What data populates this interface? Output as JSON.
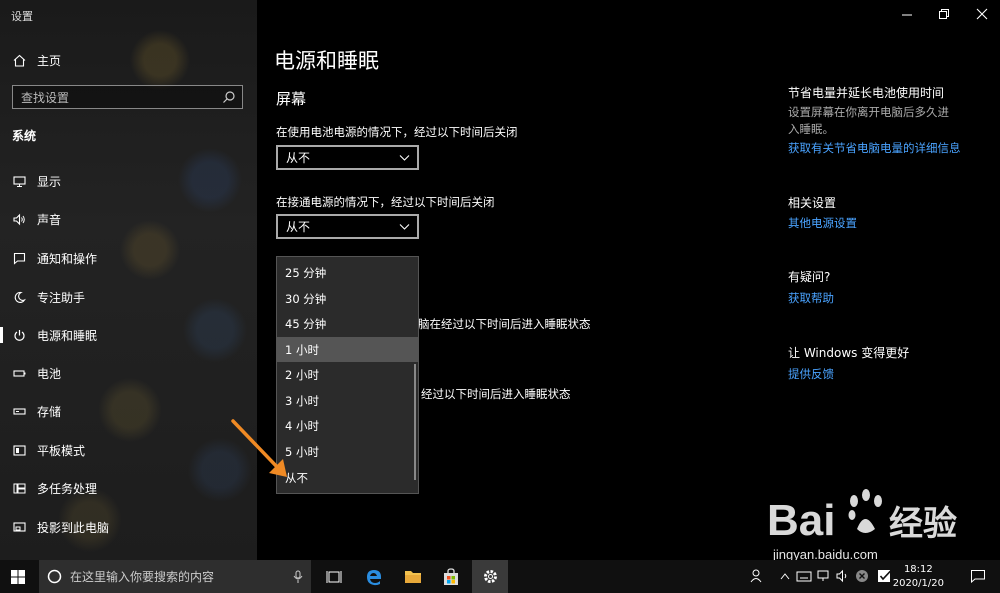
{
  "window": {
    "app_title": "设置"
  },
  "sidebar": {
    "home_label": "主页",
    "search_placeholder": "查找设置",
    "section_label": "系统",
    "items": [
      {
        "label": "显示",
        "icon": "monitor-icon"
      },
      {
        "label": "声音",
        "icon": "speaker-icon"
      },
      {
        "label": "通知和操作",
        "icon": "notification-icon"
      },
      {
        "label": "专注助手",
        "icon": "moon-icon"
      },
      {
        "label": "电源和睡眠",
        "icon": "power-icon",
        "active": true
      },
      {
        "label": "电池",
        "icon": "battery-icon"
      },
      {
        "label": "存储",
        "icon": "storage-icon"
      },
      {
        "label": "平板模式",
        "icon": "tablet-icon"
      },
      {
        "label": "多任务处理",
        "icon": "multitask-icon"
      },
      {
        "label": "投影到此电脑",
        "icon": "project-icon"
      }
    ]
  },
  "main": {
    "page_title": "电源和睡眠",
    "screen_heading": "屏幕",
    "battery_screen_label": "在使用电池电源的情况下，经过以下时间后关闭",
    "battery_screen_value": "从不",
    "plugged_screen_label": "在接通电源的情况下，经过以下时间后关闭",
    "plugged_screen_value": "从不",
    "sleep_battery_label_partial": "脑在经过以下时间后进入睡眠状态",
    "sleep_plugged_label_partial": "经过以下时间后进入睡眠状态",
    "dropdown": {
      "options": [
        "25 分钟",
        "30 分钟",
        "45 分钟",
        "1 小时",
        "2 小时",
        "3 小时",
        "4 小时",
        "5 小时",
        "从不"
      ],
      "selected_index": 3
    }
  },
  "right_panel": {
    "save_heading": "节省电量并延长电池使用时间",
    "save_text": "设置屏幕在你离开电脑后多久进入睡眠。",
    "save_link": "获取有关节省电脑电量的详细信息",
    "related_heading": "相关设置",
    "related_link": "其他电源设置",
    "question_heading": "有疑问?",
    "help_link": "获取帮助",
    "improve_heading": "让 Windows 变得更好",
    "feedback_link": "提供反馈"
  },
  "taskbar": {
    "search_placeholder": "在这里输入你要搜索的内容",
    "time": "18:12",
    "date": "2020/1/20"
  },
  "watermark": {
    "brand": "Bai",
    "brand_cn": "经验",
    "url": "jingyan.baidu.com"
  },
  "colors": {
    "link": "#4aa3ff",
    "arrow": "#f08a24",
    "selected_option": "#555555"
  }
}
